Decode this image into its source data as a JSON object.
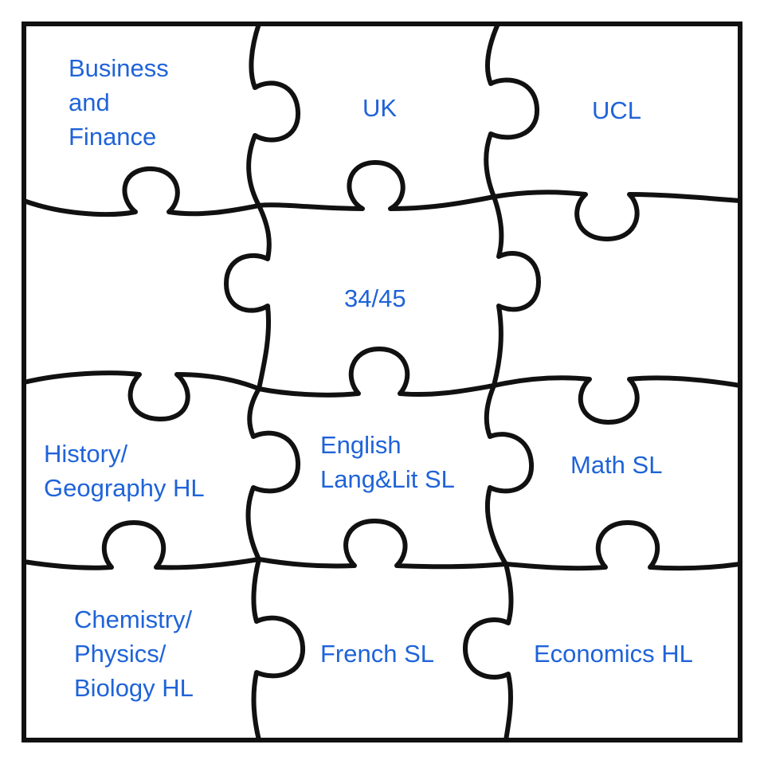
{
  "pieces": {
    "business": "Business\nand\nFinance",
    "uk": "UK",
    "ucl": "UCL",
    "mid_left": "",
    "score": "34/45",
    "mid_right": "",
    "history": "History/\nGeography HL",
    "english": "English\nLang&Lit SL",
    "math": "Math SL",
    "sciences": "Chemistry/\nPhysics/\nBiology HL",
    "french": "French SL",
    "economics": "Economics HL"
  },
  "colors": {
    "text": "#1f63d9",
    "outline": "#111111",
    "background": "#ffffff"
  }
}
